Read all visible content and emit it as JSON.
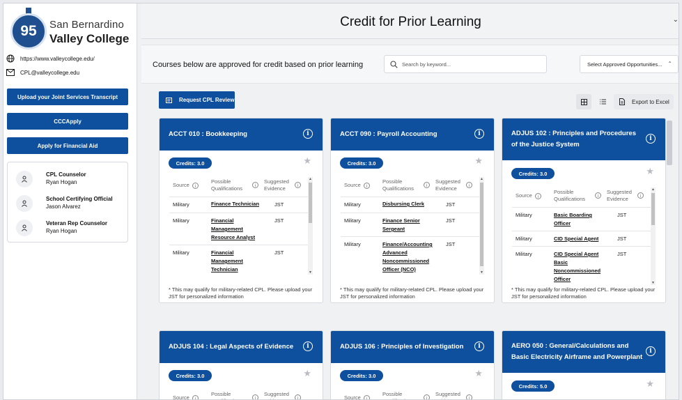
{
  "sidebar": {
    "logo": {
      "number": "95",
      "line1": "San Bernardino",
      "line2": "Valley College"
    },
    "website": "https://www.valleycollege.edu/",
    "email": "CPL@valleycollege.edu",
    "buttons": [
      "Upload your Joint Services Transcript",
      "CCCApply",
      "Apply for Financial Aid"
    ],
    "counselors": [
      {
        "role": "CPL Counselor",
        "name": "Ryan Hogan"
      },
      {
        "role": "School Certifying Official",
        "name": "Jason Alvarez"
      },
      {
        "role": "Veteran Rep Counselor",
        "name": "Ryan Hogan"
      }
    ]
  },
  "header": {
    "title": "Credit for Prior Learning",
    "chevron": "⌄"
  },
  "toolbar": {
    "description": "Courses below are approved for credit based on prior learning",
    "search_placeholder": "Search by keyword...",
    "select_value": "Select Approved Opportunities...",
    "request_button": "Request CPL Review",
    "export_button": "Export to Excel"
  },
  "table_headers": {
    "source": "Source",
    "qualifications": [
      "Possible",
      "Qualifications"
    ],
    "evidence": [
      "Suggested",
      "Evidence"
    ]
  },
  "cards": [
    {
      "title": "ACCT 010 : Bookkeeping",
      "credits": "Credits: 3.0",
      "rows": [
        {
          "source": "Military",
          "qual": "Finance Technician",
          "evidence": "JST"
        },
        {
          "source": "Military",
          "qual": "Financial Management Resource Analyst",
          "evidence": "JST"
        },
        {
          "source": "Military",
          "qual": "Financial Management Technician",
          "evidence": "JST"
        }
      ],
      "note": "* This may qualify for military-related CPL. Please upload your JST for personalized information"
    },
    {
      "title": "ACCT 090 : Payroll Accounting",
      "credits": "Credits: 3.0",
      "rows": [
        {
          "source": "Military",
          "qual": "Disbursing Clerk",
          "evidence": "JST"
        },
        {
          "source": "Military",
          "qual": "Finance Senior Sergeant",
          "evidence": "JST"
        },
        {
          "source": "Military",
          "qual": "Finance/Accounting Advanced Noncommissioned Officer (NCO)",
          "evidence": "JST"
        }
      ],
      "note": "* This may qualify for military-related CPL. Please upload your JST for personalized information"
    },
    {
      "title": "ADJUS 102 : Principles and Procedures of the Justice System",
      "credits": "Credits: 3.0",
      "rows": [
        {
          "source": "Military",
          "qual": "Basic Boarding Officer",
          "evidence": "JST"
        },
        {
          "source": "Military",
          "qual": "CID Special Agent",
          "evidence": "JST"
        },
        {
          "source": "Military",
          "qual": "CID Special Agent Basic Noncommissioned Officer",
          "evidence": "JST"
        }
      ],
      "note": "* This may qualify for military-related CPL. Please upload your JST for personalized information"
    },
    {
      "title": "ADJUS 104 : Legal Aspects of Evidence",
      "credits": "Credits: 3.0"
    },
    {
      "title": "ADJUS 106 : Principles of Investigation",
      "credits": "Credits: 3.0"
    },
    {
      "title": "AERO 050 : General/Calculations and Basic Electricity Airframe and Powerplant",
      "credits": "Credits: 5.0"
    }
  ],
  "colors": {
    "primary": "#0e4f9e",
    "background": "#f0f1f3"
  },
  "icons": [
    "globe-icon",
    "mail-icon",
    "user-icon",
    "search-icon",
    "grid-view-icon",
    "list-view-icon",
    "document-icon",
    "info-icon",
    "star-icon"
  ]
}
